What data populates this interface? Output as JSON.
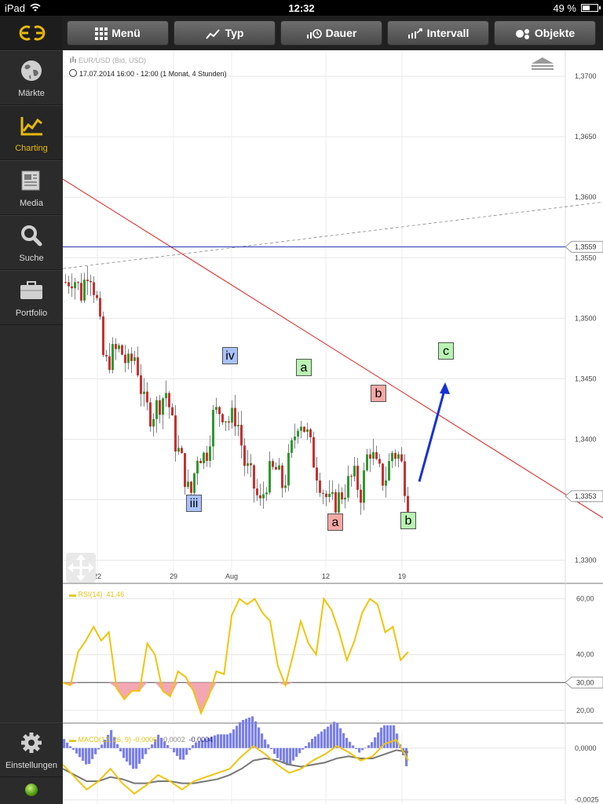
{
  "status_bar": {
    "device": "iPad",
    "time": "12:32",
    "battery": "49 %",
    "battery_level": 0.49
  },
  "sidebar": {
    "items": [
      {
        "label": "Märkte",
        "icon": "globe-icon"
      },
      {
        "label": "Charting",
        "icon": "chart-icon",
        "active": true
      },
      {
        "label": "Media",
        "icon": "newspaper-icon"
      },
      {
        "label": "Suche",
        "icon": "search-icon"
      },
      {
        "label": "Portfolio",
        "icon": "briefcase-icon"
      }
    ],
    "settings_label": "Einstellungen"
  },
  "toolbar": {
    "menu": "Menü",
    "type": "Typ",
    "duration": "Dauer",
    "interval": "Intervall",
    "objects": "Objekte"
  },
  "chart": {
    "instrument": "EUR/USD (Bid, USD)",
    "period": "17.07.2014 16:00 - 12:00 (1 Monat, 4 Stunden)",
    "current_price_tag": "1,3353",
    "hline_price_tag": "1,3559",
    "wave_labels": [
      "iii",
      "iv",
      "a",
      "b",
      "a",
      "b",
      "c"
    ]
  },
  "rsi": {
    "label": "RSI(14)",
    "value": "41,46",
    "level_tag": "30,00"
  },
  "macd": {
    "label": "MACD(12, 26, 9)",
    "v1": "-0,0006",
    "v2": "-0,0002",
    "v3": "-0,0004"
  },
  "colors": {
    "up": "#2e9a2e",
    "down": "#c83030",
    "trend": "#e02020",
    "hline": "#1a2db0",
    "arrow": "#1531d8",
    "rsi": "#f0c40c",
    "accent": "#e8b90d"
  },
  "chart_data": [
    {
      "type": "candlestick",
      "title": "EUR/USD (Bid, USD)",
      "x_ticks": [
        "22",
        "29",
        "Aug",
        "12",
        "19"
      ],
      "y_ticks": [
        "1,3700",
        "1,3650",
        "1,3600",
        "1,3550",
        "1,3500",
        "1,3450",
        "1,3400",
        "1,3350",
        "1,3300"
      ],
      "ylim": [
        1.329,
        1.3715
      ],
      "last_price": 1.3353,
      "horizontal_line": 1.3559,
      "close_path": [
        1.353,
        1.3535,
        1.352,
        1.3545,
        1.3515,
        1.346,
        1.347,
        1.3475,
        1.346,
        1.347,
        1.343,
        1.342,
        1.343,
        1.344,
        1.34,
        1.338,
        1.335,
        1.339,
        1.3385,
        1.342,
        1.3425,
        1.3415,
        1.342,
        1.338,
        1.3365,
        1.3345,
        1.337,
        1.3375,
        1.336,
        1.339,
        1.342,
        1.3405,
        1.338,
        1.336,
        1.3345,
        1.335,
        1.336,
        1.337,
        1.3355,
        1.3395,
        1.3375,
        1.3365,
        1.339,
        1.3385,
        1.335
      ]
    },
    {
      "type": "line",
      "title": "RSI(14)",
      "y_ticks": [
        "60,00",
        "40,00",
        "30,00",
        "20,00"
      ],
      "ylim": [
        16,
        63
      ],
      "level": 30,
      "values": [
        30,
        29,
        41,
        45,
        50,
        45,
        48,
        28,
        24,
        27,
        27,
        44,
        40,
        27,
        25,
        34,
        32,
        27,
        19,
        25,
        34,
        33,
        54,
        60,
        58,
        60,
        55,
        52,
        36,
        29,
        40,
        52,
        44,
        40,
        60,
        56,
        48,
        38,
        45,
        55,
        60,
        58,
        48,
        50,
        38,
        41
      ]
    },
    {
      "type": "line",
      "title": "MACD(12, 26, 9)",
      "y_ticks": [
        "0,0000",
        "-0,0025"
      ],
      "ylim": [
        -0.0027,
        0.0009
      ],
      "values": [
        -0.0008,
        -0.0014,
        -0.002,
        -0.0016,
        -0.001,
        -0.0017,
        -0.0022,
        -0.0018,
        -0.0013,
        -0.0016,
        -0.002,
        -0.0016,
        -0.0014,
        -0.0012,
        -0.001,
        -0.0004,
        0.0001,
        -0.0003,
        -0.0008,
        -0.0012,
        -0.001,
        -0.0006,
        -0.0003,
        0.0001,
        -0.0002,
        -0.0006,
        -0.0004,
        0.0002,
        0.0004,
        -0.0006
      ],
      "signal": [
        -0.001,
        -0.0013,
        -0.0016,
        -0.0016,
        -0.0014,
        -0.0015,
        -0.0017,
        -0.0017,
        -0.0016,
        -0.0016,
        -0.0017,
        -0.0017,
        -0.0016,
        -0.0015,
        -0.0013,
        -0.001,
        -0.0006,
        -0.0005,
        -0.0006,
        -0.0008,
        -0.0009,
        -0.0008,
        -0.0007,
        -0.0005,
        -0.0004,
        -0.0005,
        -0.0005,
        -0.0003,
        -0.0001,
        -0.0002
      ]
    }
  ]
}
